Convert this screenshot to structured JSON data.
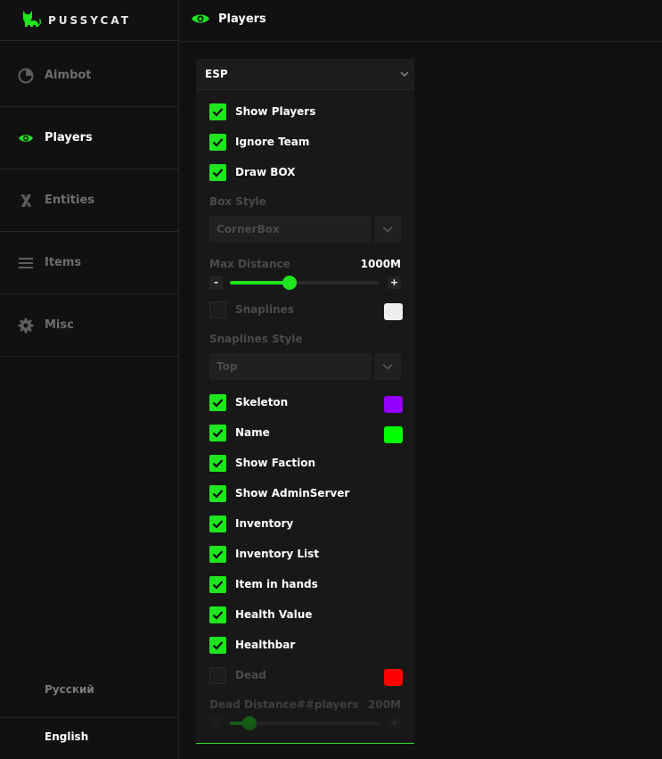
{
  "brand": {
    "name": "PUSSYCAT",
    "icon": "cat-icon"
  },
  "accent_color": "#1ee61e",
  "nav": [
    {
      "label": "Aimbot",
      "icon": "target-icon",
      "active": false
    },
    {
      "label": "Players",
      "icon": "eye-icon",
      "active": true
    },
    {
      "label": "Entities",
      "icon": "x-logo-icon",
      "active": false
    },
    {
      "label": "Items",
      "icon": "menu-lines-icon",
      "active": false
    },
    {
      "label": "Misc",
      "icon": "gear-icon",
      "active": false
    }
  ],
  "languages": [
    {
      "label": "Русский",
      "active": false
    },
    {
      "label": "English",
      "active": true
    }
  ],
  "header": {
    "title": "Players",
    "icon": "eye-icon"
  },
  "panel": {
    "title": "ESP",
    "options": {
      "show_players": {
        "label": "Show Players",
        "checked": true
      },
      "ignore_team": {
        "label": "Ignore Team",
        "checked": true
      },
      "draw_box": {
        "label": "Draw BOX",
        "checked": true
      },
      "snaplines": {
        "label": "Snaplines",
        "checked": false,
        "color": "#eeeeee"
      },
      "skeleton": {
        "label": "Skeleton",
        "checked": true,
        "color": "#9400ff"
      },
      "name": {
        "label": "Name",
        "checked": true,
        "color": "#00ff00"
      },
      "show_faction": {
        "label": "Show Faction",
        "checked": true
      },
      "show_adminserver": {
        "label": "Show AdminServer",
        "checked": true
      },
      "inventory": {
        "label": "Inventory",
        "checked": true
      },
      "inventory_list": {
        "label": "Inventory List",
        "checked": true
      },
      "item_in_hands": {
        "label": "Item in hands",
        "checked": true
      },
      "health_value": {
        "label": "Health Value",
        "checked": true
      },
      "healthbar": {
        "label": "Healthbar",
        "checked": true
      },
      "dead": {
        "label": "Dead",
        "checked": false,
        "color": "#ff0000"
      }
    },
    "box_style": {
      "label": "Box Style",
      "value": "CornerBox"
    },
    "max_distance": {
      "label": "Max Distance",
      "value": "1000M",
      "fraction": 0.4,
      "minus": "-",
      "plus": "+"
    },
    "snaplines_style": {
      "label": "Snaplines Style",
      "value": "Top"
    },
    "dead_distance": {
      "label": "Dead Distance##players",
      "value": "200M",
      "fraction": 0.13,
      "minus": "-",
      "plus": "+"
    }
  }
}
